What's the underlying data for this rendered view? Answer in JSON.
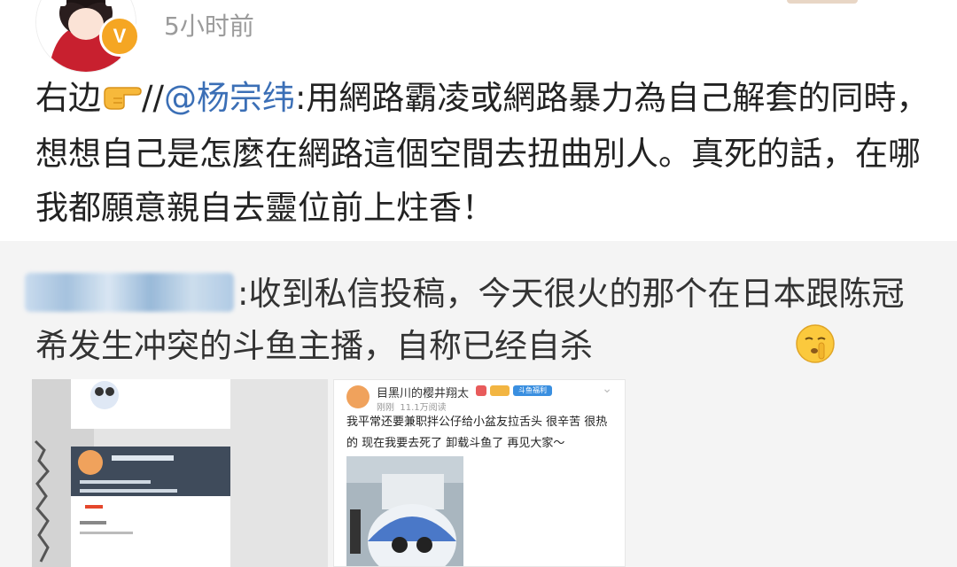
{
  "post": {
    "time": "5小时前",
    "prefix": "右边",
    "slashes": "//",
    "mention": "@杨宗纬",
    "colon_text": ":用網路霸凌或網路暴力為自己解套的同時，想想自己是怎麼在網路這個空間去扭曲別人。真死的話，在哪我都願意親自去靈位前上炷香！"
  },
  "repost": {
    "text": ":收到私信投稿，今天很火的那个在日本跟陈冠希发生冲突的斗鱼主播，自称已经自杀"
  },
  "image2": {
    "name": "目黑川的樱井翔太",
    "time": "刚刚",
    "reads": "11.1万阅读",
    "badge_text": "斗鱼福利",
    "body": "我平常还要兼职拌公仔给小盆友拉舌头 很辛苦 很热的 现在我要去死了 卸载斗鱼了 再见大家～"
  },
  "icons": {
    "verified": "verified-badge-icon",
    "pointing_hand": "pointing-hand-emoji-icon",
    "shush": "shushing-face-emoji-icon"
  },
  "colors": {
    "link": "#3b6fb6",
    "time": "#9b9b9b",
    "repost_bg": "#f4f4f4",
    "verified": "#f5a623"
  }
}
